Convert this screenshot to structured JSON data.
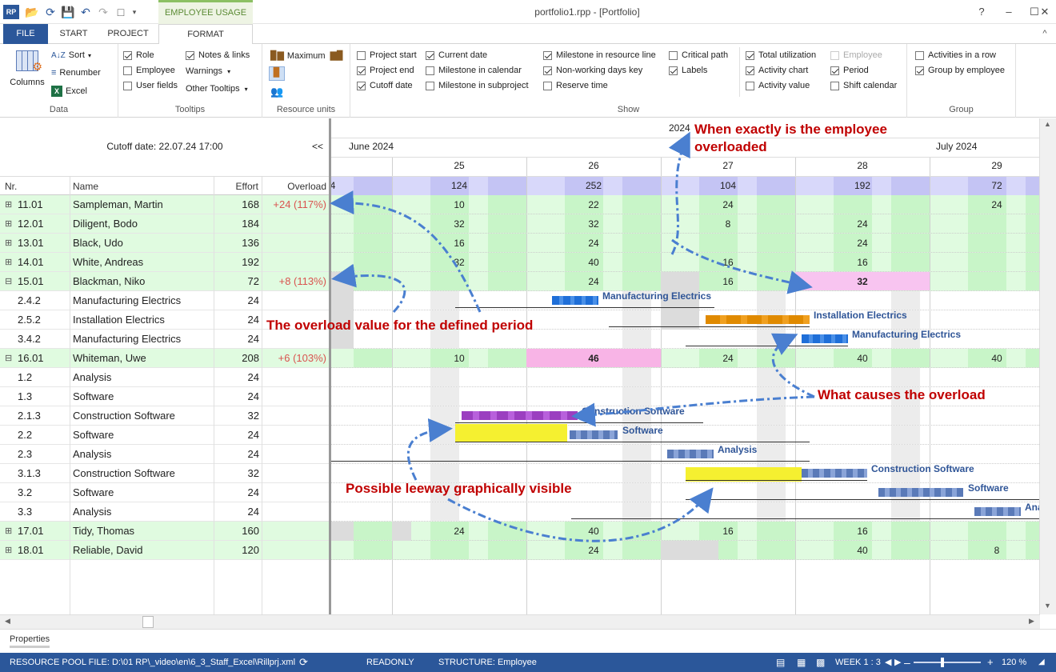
{
  "titlebar": {
    "app_icon": "app-logo",
    "context_tab": "EMPLOYEE USAGE",
    "title": "portfolio1.rpp - [Portfolio]",
    "controls": [
      "?",
      "–",
      "☐",
      "✕"
    ]
  },
  "tabs": {
    "file": "FILE",
    "start": "START",
    "project": "PROJECT",
    "format": "FORMAT",
    "collapse": "^"
  },
  "ribbon": {
    "data": {
      "label": "Data",
      "columns": "Columns",
      "sort": "Sort",
      "renumber": "Renumber",
      "excel": "Excel"
    },
    "tooltips": {
      "label": "Tooltips",
      "role": "Role",
      "employee": "Employee",
      "user_fields": "User fields",
      "notes_links": "Notes & links",
      "warnings": "Warnings",
      "other_tooltips": "Other Tooltips"
    },
    "resource_units": {
      "label": "Resource units",
      "maximum": "Maximum"
    },
    "show": {
      "label": "Show",
      "project_start": "Project start",
      "project_end": "Project end",
      "cutoff_date": "Cutoff date",
      "current_date": "Current date",
      "milestone_calendar": "Milestone in calendar",
      "milestone_subproject": "Milestone in subproject",
      "milestone_resource": "Milestone in resource line",
      "non_working": "Non-working days key",
      "reserve_time": "Reserve time",
      "critical_path": "Critical path",
      "labels": "Labels",
      "total_utilization": "Total utilization",
      "activity_chart": "Activity chart",
      "activity_value": "Activity value",
      "employee": "Employee",
      "period": "Period",
      "shift_calendar": "Shift calendar"
    },
    "group": {
      "label": "Group",
      "activities_row": "Activities in a row",
      "group_employee": "Group by employee"
    }
  },
  "left": {
    "cutoff": "Cutoff date: 22.07.24 17:00",
    "collapse_btn": "<<",
    "headers": {
      "nr": "Nr.",
      "name": "Name",
      "effort": "Effort",
      "overload": "Overload"
    },
    "rows": [
      {
        "nr": "11.01",
        "name": "Sampleman, Martin",
        "effort": "168",
        "overload": "+24 (117%)",
        "group": true
      },
      {
        "nr": "12.01",
        "name": "Diligent, Bodo",
        "effort": "184",
        "overload": "",
        "group": true
      },
      {
        "nr": "13.01",
        "name": "Black, Udo",
        "effort": "136",
        "overload": "",
        "group": true
      },
      {
        "nr": "14.01",
        "name": "White, Andreas",
        "effort": "192",
        "overload": "",
        "group": true
      },
      {
        "nr": "15.01",
        "name": "Blackman, Niko",
        "effort": "72",
        "overload": "+8 (113%)",
        "group": true,
        "open": true
      },
      {
        "nr": "2.4.2",
        "name": "Manufacturing Electrics",
        "effort": "24",
        "overload": "",
        "group": false
      },
      {
        "nr": "2.5.2",
        "name": "Installation Electrics",
        "effort": "24",
        "overload": "",
        "group": false
      },
      {
        "nr": "3.4.2",
        "name": "Manufacturing Electrics",
        "effort": "24",
        "overload": "",
        "group": false
      },
      {
        "nr": "16.01",
        "name": "Whiteman, Uwe",
        "effort": "208",
        "overload": "+6 (103%)",
        "group": true,
        "open": true
      },
      {
        "nr": "1.2",
        "name": "Analysis",
        "effort": "24",
        "overload": "",
        "group": false
      },
      {
        "nr": "1.3",
        "name": "Software",
        "effort": "24",
        "overload": "",
        "group": false
      },
      {
        "nr": "2.1.3",
        "name": "Construction Software",
        "effort": "32",
        "overload": "",
        "group": false
      },
      {
        "nr": "2.2",
        "name": "Software",
        "effort": "24",
        "overload": "",
        "group": false
      },
      {
        "nr": "2.3",
        "name": "Analysis",
        "effort": "24",
        "overload": "",
        "group": false
      },
      {
        "nr": "3.1.3",
        "name": "Construction Software",
        "effort": "32",
        "overload": "",
        "group": false
      },
      {
        "nr": "3.2",
        "name": "Software",
        "effort": "24",
        "overload": "",
        "group": false
      },
      {
        "nr": "3.3",
        "name": "Analysis",
        "effort": "24",
        "overload": "",
        "group": false
      },
      {
        "nr": "17.01",
        "name": "Tidy, Thomas",
        "effort": "160",
        "overload": "",
        "group": true
      },
      {
        "nr": "18.01",
        "name": "Reliable, David",
        "effort": "120",
        "overload": "",
        "group": true
      }
    ]
  },
  "chart": {
    "year": "2024",
    "month_left": "June 2024",
    "month_right": "July 2024",
    "weeks": [
      "25",
      "26",
      "27",
      "28",
      "29"
    ],
    "totals": [
      "124",
      "252",
      "104",
      "192",
      "72"
    ],
    "total_partial": "4",
    "values": {
      "r0": [
        "10",
        "22",
        "24",
        "",
        "24"
      ],
      "r1": [
        "32",
        "32",
        "8",
        "24",
        ""
      ],
      "r2": [
        "16",
        "24",
        "",
        "24",
        ""
      ],
      "r3": [
        "32",
        "40",
        "16",
        "16",
        ""
      ],
      "r4": [
        "",
        "24",
        "16",
        "32",
        ""
      ],
      "r8": [
        "10",
        "46",
        "24",
        "40",
        "40"
      ],
      "r17": [
        "24",
        "40",
        "16",
        "16",
        ""
      ],
      "r18": [
        "",
        "24",
        "",
        "40",
        "8"
      ]
    },
    "bars": {
      "manufacturing_electrics_1": "Manufacturing Electrics",
      "installation_electrics": "Installation Electrics",
      "manufacturing_electrics_2": "Manufacturing Electrics",
      "construction_software_1": "Construction Software",
      "software_1": "Software",
      "analysis": "Analysis",
      "construction_software_2": "Construction Software",
      "software_2": "Software",
      "analysis_cut": "Ana"
    },
    "colors": {
      "overload": "#f8b4e6",
      "light_green": "#e0fbe0",
      "mid_green": "#c6f5c6",
      "purple_row": "#d4d4f8",
      "bar_blue": "#1f6fd8",
      "bar_orange": "#e08a00",
      "bar_purple": "#9b3fc0",
      "bar_yellow": "#f5f030",
      "bar_slate": "#5a7ab8"
    }
  },
  "annotations": {
    "when_overloaded": "When exactly is the employee overloaded",
    "overload_value": "The overload value for the defined period",
    "causes": "What causes the overload",
    "leeway": "Possible leeway graphically visible"
  },
  "props": {
    "label": "Properties"
  },
  "status": {
    "file": "RESOURCE POOL FILE: D:\\01 RP\\_video\\en\\6_3_Staff_Excel\\Rillprj.xml",
    "readonly": "READONLY",
    "structure": "STRUCTURE: Employee",
    "week": "WEEK 1 : 3",
    "zoom": "120 %"
  }
}
